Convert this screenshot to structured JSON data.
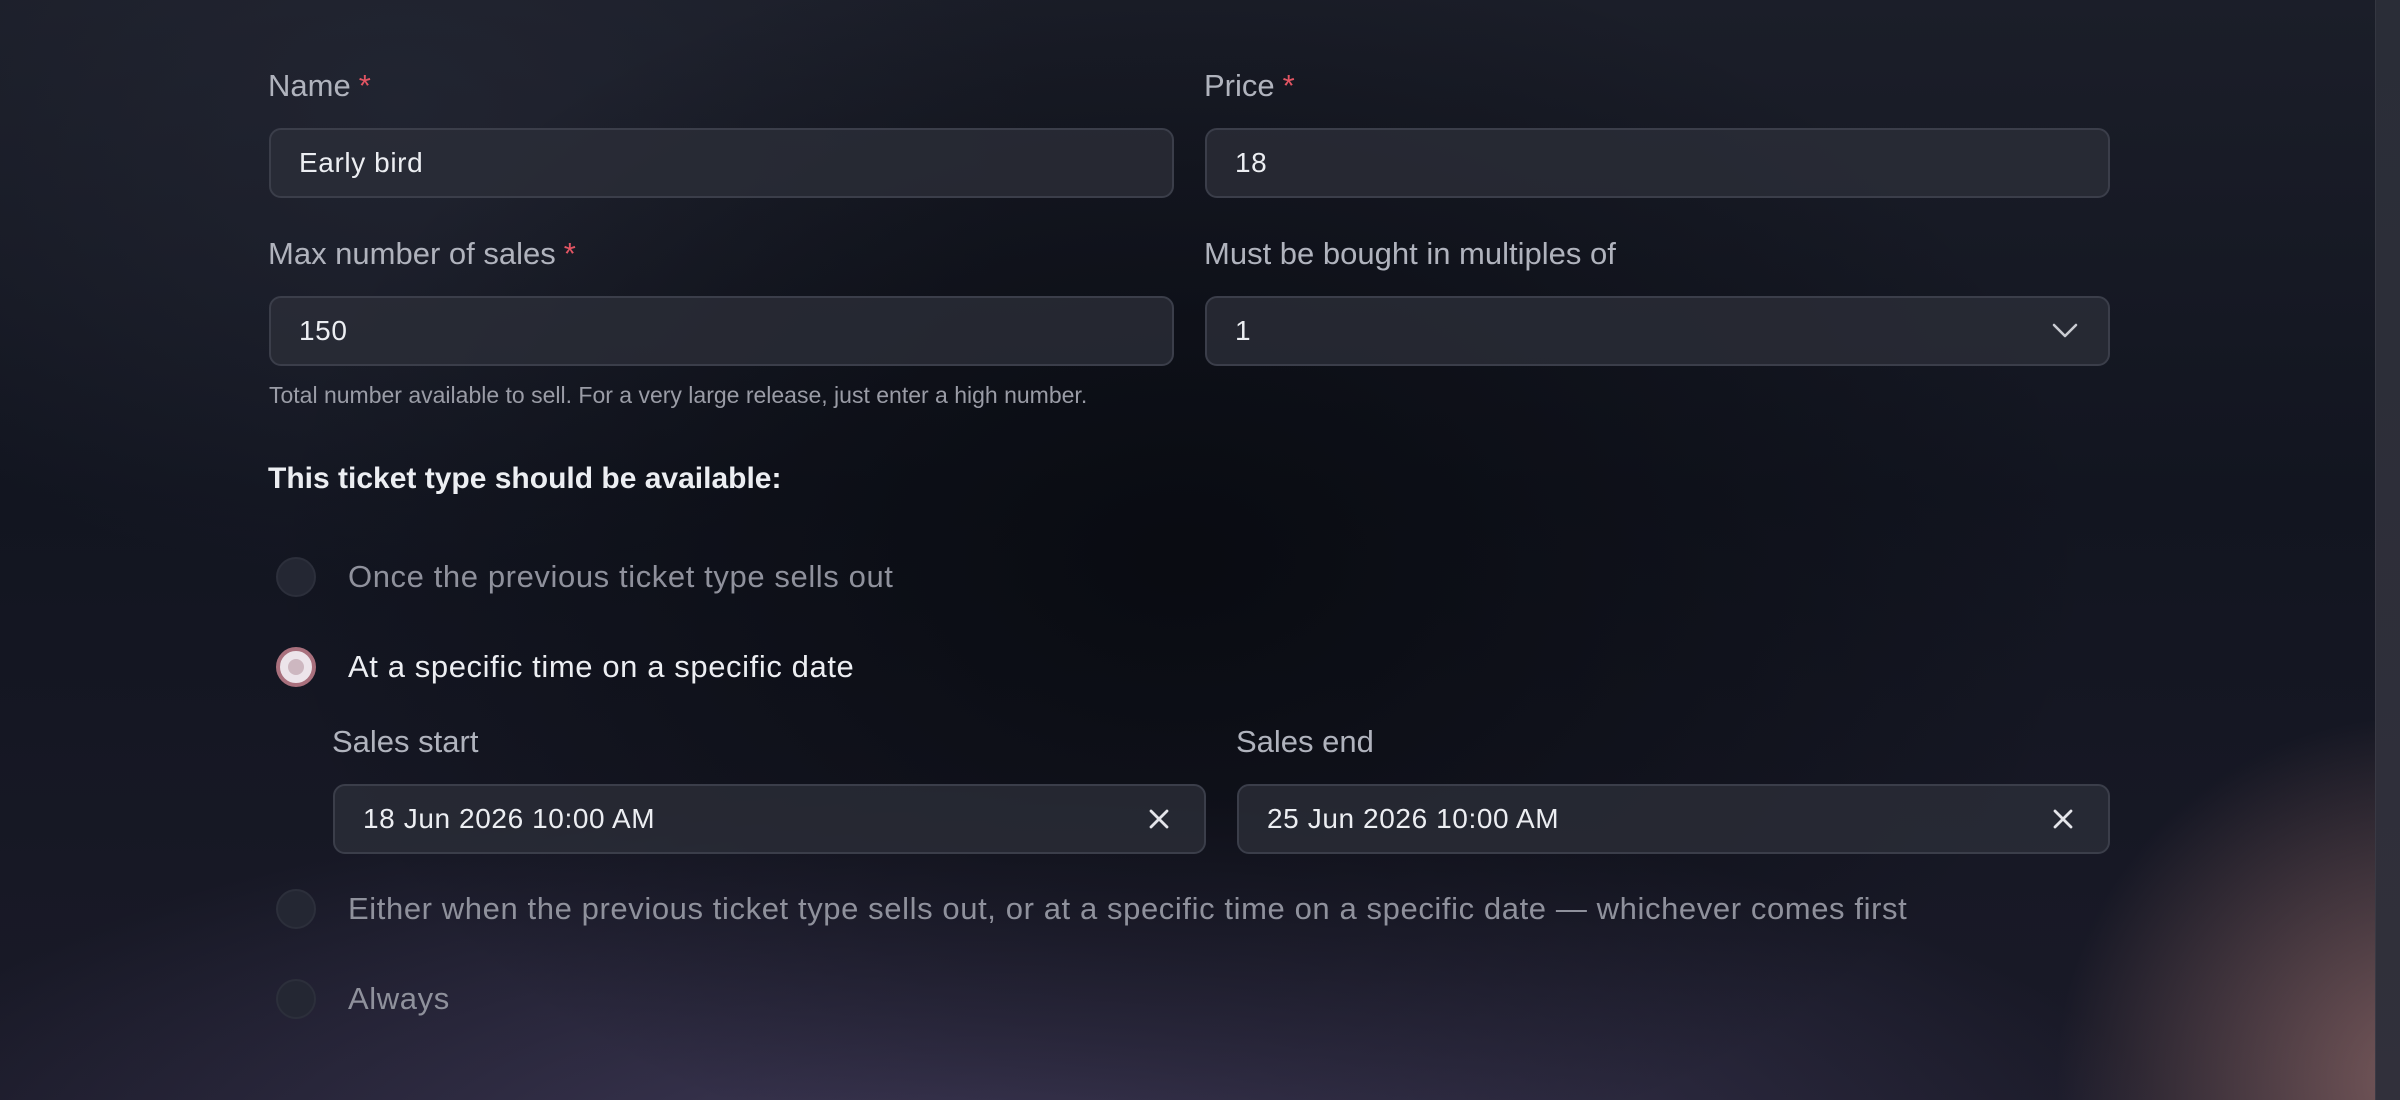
{
  "form": {
    "name": {
      "label": "Name",
      "required_mark": "*",
      "value": "Early bird"
    },
    "price": {
      "label": "Price",
      "required_mark": "*",
      "value": "18"
    },
    "max_sales": {
      "label": "Max number of sales",
      "required_mark": "*",
      "value": "150",
      "help": "Total number available to sell. For a very large release, just enter a high number."
    },
    "multiples": {
      "label": "Must be bought in multiples of",
      "value": "1",
      "icon": "chevron-down-icon"
    }
  },
  "availability": {
    "title": "This ticket type should be available:",
    "options": [
      {
        "label": "Once the previous ticket type sells out",
        "selected": false
      },
      {
        "label": "At a specific time on a specific date",
        "selected": true
      },
      {
        "label": "Either when the previous ticket type sells out, or at a specific time on a specific date — whichever comes first",
        "selected": false
      },
      {
        "label": "Always",
        "selected": false
      }
    ],
    "sales_start": {
      "label": "Sales start",
      "value": "18 Jun 2026 10:00 AM",
      "icon": "close-icon"
    },
    "sales_end": {
      "label": "Sales end",
      "value": "25 Jun 2026 10:00 AM",
      "icon": "close-icon"
    }
  },
  "colors": {
    "background": "#121520",
    "field_bg": "#2c2e38",
    "field_border": "#3b3e4a",
    "required": "#e25563",
    "radio_selected_ring": "#a9707d"
  }
}
